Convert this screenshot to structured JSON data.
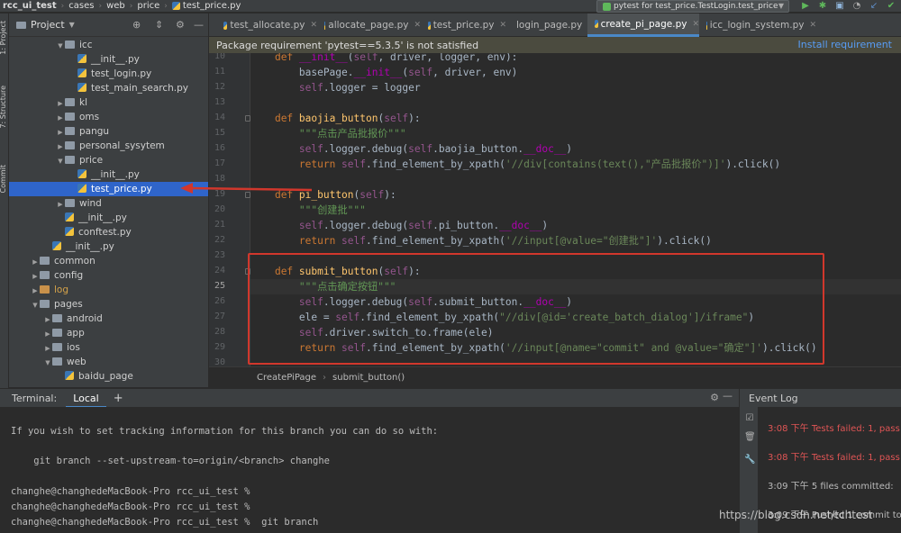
{
  "breadcrumbs": [
    "rcc_ui_test",
    "cases",
    "web",
    "price",
    "test_price.py"
  ],
  "run_config": "pytest for test_price.TestLogin.test_price",
  "project_panel": {
    "title": "Project",
    "tree": [
      {
        "label": "icc",
        "level": 3,
        "kind": "folder",
        "expanded": true
      },
      {
        "label": "__init__.py",
        "level": 4,
        "kind": "py"
      },
      {
        "label": "test_login.py",
        "level": 4,
        "kind": "py"
      },
      {
        "label": "test_main_search.py",
        "level": 4,
        "kind": "py"
      },
      {
        "label": "kl",
        "level": 3,
        "kind": "folder",
        "expanded": false
      },
      {
        "label": "oms",
        "level": 3,
        "kind": "folder",
        "expanded": false
      },
      {
        "label": "pangu",
        "level": 3,
        "kind": "folder",
        "expanded": false
      },
      {
        "label": "personal_sysytem",
        "level": 3,
        "kind": "folder",
        "expanded": false
      },
      {
        "label": "price",
        "level": 3,
        "kind": "folder",
        "expanded": true
      },
      {
        "label": "__init__.py",
        "level": 4,
        "kind": "py"
      },
      {
        "label": "test_price.py",
        "level": 4,
        "kind": "py",
        "selected": true
      },
      {
        "label": "wind",
        "level": 3,
        "kind": "folder",
        "expanded": false
      },
      {
        "label": "__init__.py",
        "level": 3,
        "kind": "py"
      },
      {
        "label": "conftest.py",
        "level": 3,
        "kind": "py"
      },
      {
        "label": "__init__.py",
        "level": 2,
        "kind": "py"
      },
      {
        "label": "common",
        "level": 1,
        "kind": "folder",
        "expanded": false
      },
      {
        "label": "config",
        "level": 1,
        "kind": "folder",
        "expanded": false
      },
      {
        "label": "log",
        "level": 1,
        "kind": "folder-orange",
        "expanded": false
      },
      {
        "label": "pages",
        "level": 1,
        "kind": "folder",
        "expanded": true
      },
      {
        "label": "android",
        "level": 2,
        "kind": "folder",
        "expanded": false
      },
      {
        "label": "app",
        "level": 2,
        "kind": "folder",
        "expanded": false
      },
      {
        "label": "ios",
        "level": 2,
        "kind": "folder",
        "expanded": false
      },
      {
        "label": "web",
        "level": 2,
        "kind": "folder",
        "expanded": true
      },
      {
        "label": "baidu_page",
        "level": 3,
        "kind": "py"
      }
    ]
  },
  "editor_tabs": [
    {
      "label": "test_allocate.py",
      "active": false
    },
    {
      "label": "allocate_page.py",
      "active": false
    },
    {
      "label": "test_price.py",
      "active": false
    },
    {
      "label": "login_page.py",
      "active": false
    },
    {
      "label": "create_pi_page.py",
      "active": true
    },
    {
      "label": "icc_login_system.py",
      "active": false
    }
  ],
  "notification": {
    "message": "Package requirement 'pytest==5.3.5' is not satisfied",
    "action": "Install requirement"
  },
  "code_lines": [
    {
      "num": "10",
      "segments": [
        [
          "plain",
          "    "
        ],
        [
          "kw",
          "def "
        ],
        [
          "magic",
          "__init__"
        ],
        [
          "plain",
          "("
        ],
        [
          "self",
          "self"
        ],
        [
          "plain",
          ", driver, logger, env):"
        ]
      ]
    },
    {
      "num": "11",
      "segments": [
        [
          "plain",
          "        basePage."
        ],
        [
          "magic",
          "__init__"
        ],
        [
          "plain",
          "("
        ],
        [
          "self",
          "self"
        ],
        [
          "plain",
          ", driver, env)"
        ]
      ]
    },
    {
      "num": "12",
      "segments": [
        [
          "plain",
          "        "
        ],
        [
          "self",
          "self"
        ],
        [
          "plain",
          ".logger = logger"
        ]
      ]
    },
    {
      "num": "13",
      "segments": [
        [
          "plain",
          ""
        ]
      ]
    },
    {
      "num": "14",
      "segments": [
        [
          "plain",
          "    "
        ],
        [
          "kw",
          "def "
        ],
        [
          "fn",
          "baojia_button"
        ],
        [
          "plain",
          "("
        ],
        [
          "self",
          "self"
        ],
        [
          "plain",
          "):"
        ]
      ]
    },
    {
      "num": "15",
      "segments": [
        [
          "doc",
          "        \"\"\"点击产品批报价\"\"\""
        ]
      ]
    },
    {
      "num": "16",
      "segments": [
        [
          "plain",
          "        "
        ],
        [
          "self",
          "self"
        ],
        [
          "plain",
          ".logger.debug("
        ],
        [
          "self",
          "self"
        ],
        [
          "plain",
          ".baojia_button."
        ],
        [
          "magic",
          "__doc__"
        ],
        [
          "plain",
          ")"
        ]
      ]
    },
    {
      "num": "17",
      "segments": [
        [
          "plain",
          "        "
        ],
        [
          "kw",
          "return "
        ],
        [
          "self",
          "self"
        ],
        [
          "plain",
          ".find_element_by_xpath("
        ],
        [
          "str",
          "'//div[contains(text(),\"产品批报价\")]'"
        ],
        [
          "plain",
          ").click()"
        ]
      ]
    },
    {
      "num": "18",
      "segments": [
        [
          "plain",
          ""
        ]
      ]
    },
    {
      "num": "19",
      "segments": [
        [
          "plain",
          "    "
        ],
        [
          "kw",
          "def "
        ],
        [
          "fn",
          "pi_button"
        ],
        [
          "plain",
          "("
        ],
        [
          "self",
          "self"
        ],
        [
          "plain",
          "):"
        ]
      ]
    },
    {
      "num": "20",
      "segments": [
        [
          "doc",
          "        \"\"\"创建批\"\"\""
        ]
      ]
    },
    {
      "num": "21",
      "segments": [
        [
          "plain",
          "        "
        ],
        [
          "self",
          "self"
        ],
        [
          "plain",
          ".logger.debug("
        ],
        [
          "self",
          "self"
        ],
        [
          "plain",
          ".pi_button."
        ],
        [
          "magic",
          "__doc__"
        ],
        [
          "plain",
          ")"
        ]
      ]
    },
    {
      "num": "22",
      "segments": [
        [
          "plain",
          "        "
        ],
        [
          "kw",
          "return "
        ],
        [
          "self",
          "self"
        ],
        [
          "plain",
          ".find_element_by_xpath("
        ],
        [
          "str",
          "'//input[@value=\"创建批\"]'"
        ],
        [
          "plain",
          ").click()"
        ]
      ]
    },
    {
      "num": "23",
      "segments": [
        [
          "plain",
          ""
        ]
      ]
    },
    {
      "num": "24",
      "segments": [
        [
          "plain",
          "    "
        ],
        [
          "kw",
          "def "
        ],
        [
          "fn",
          "submit_button"
        ],
        [
          "plain",
          "("
        ],
        [
          "self",
          "self"
        ],
        [
          "plain",
          "):"
        ]
      ]
    },
    {
      "num": "25",
      "segments": [
        [
          "doc",
          "        \"\"\"点击确定按钮\"\"\""
        ]
      ],
      "current": true
    },
    {
      "num": "26",
      "segments": [
        [
          "plain",
          "        "
        ],
        [
          "self",
          "self"
        ],
        [
          "plain",
          ".logger.debug("
        ],
        [
          "self",
          "self"
        ],
        [
          "plain",
          ".submit_button."
        ],
        [
          "magic",
          "__doc__"
        ],
        [
          "plain",
          ")"
        ]
      ]
    },
    {
      "num": "27",
      "segments": [
        [
          "plain",
          "        ele = "
        ],
        [
          "self",
          "self"
        ],
        [
          "plain",
          ".find_element_by_xpath("
        ],
        [
          "str",
          "\"//div[@id='create_batch_dialog']/iframe\""
        ],
        [
          "plain",
          ")"
        ]
      ]
    },
    {
      "num": "28",
      "segments": [
        [
          "plain",
          "        "
        ],
        [
          "self",
          "self"
        ],
        [
          "plain",
          ".driver.switch_to.frame(ele)"
        ]
      ]
    },
    {
      "num": "29",
      "segments": [
        [
          "plain",
          "        "
        ],
        [
          "kw",
          "return "
        ],
        [
          "self",
          "self"
        ],
        [
          "plain",
          ".find_element_by_xpath("
        ],
        [
          "str",
          "'//input[@name=\"commit\" and @value=\"确定\"]'"
        ],
        [
          "plain",
          ").click()"
        ]
      ]
    },
    {
      "num": "30",
      "segments": [
        [
          "plain",
          ""
        ]
      ]
    }
  ],
  "editor_breadcrumbs": [
    "CreatePiPage",
    "submit_button()"
  ],
  "terminal": {
    "title": "Terminal:",
    "tab": "Local",
    "lines": [
      "",
      "If you wish to set tracking information for this branch you can do so with:",
      "",
      "    git branch --set-upstream-to=origin/<branch> changhe",
      "",
      "changhe@changhedeMacBook-Pro rcc_ui_test %",
      "changhe@changhedeMacBook-Pro rcc_ui_test %",
      "changhe@changhedeMacBook-Pro rcc_ui_test %  git branch"
    ]
  },
  "event_log": {
    "title": "Event Log",
    "entries": [
      {
        "time": "3:08 下午",
        "text": "Tests failed: 1, pass",
        "error": true
      },
      {
        "time": "3:08 下午",
        "text": "Tests failed: 1, pass",
        "error": true
      },
      {
        "time": "3:09 下午",
        "text": "5 files committed:",
        "error": false
      },
      {
        "time": "3:09 下午",
        "text": "Pushed 1 commit to o",
        "error": false
      }
    ]
  },
  "left_strip_tabs": [
    "1: Project",
    "7: Structure",
    "Commit"
  ],
  "watermark": "https://blog.csdn.net/tchtest"
}
